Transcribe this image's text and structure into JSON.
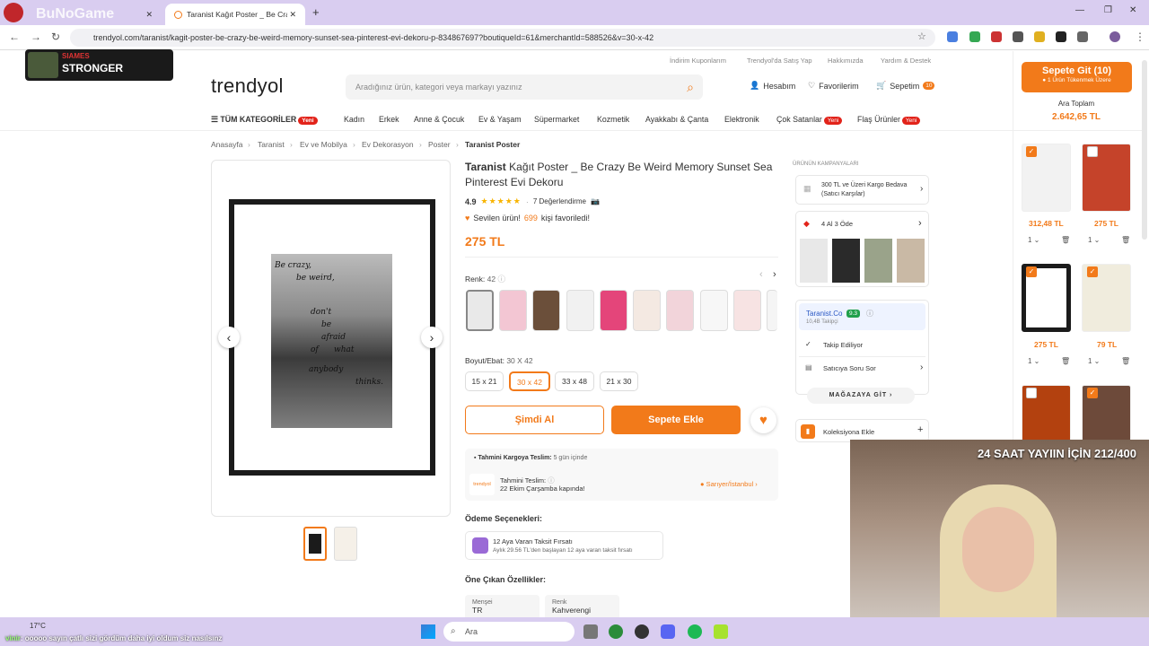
{
  "browser": {
    "tabs": [
      {
        "title": "BuNoGame",
        "active": false
      },
      {
        "title": "Taranist Kağıt Poster _ Be Crazy",
        "active": true
      }
    ],
    "url": "trendyol.com/taranist/kagit-poster-be-crazy-be-weird-memory-sunset-sea-pinterest-evi-dekoru-p-834867697?boutiqueId=61&merchantId=588526&v=30-x-42"
  },
  "overlay": {
    "stronger_top": "SIAMES",
    "stronger_main": "STRONGER",
    "stream_counter": "24 SAAT YAYIIN İÇİN 212/400"
  },
  "site": {
    "top_links": [
      "İndirim Kuponlarım",
      "Trendyol'da Satış Yap",
      "Hakkımızda",
      "Yardım & Destek"
    ],
    "logo": "trendyol",
    "search_placeholder": "Aradığınız ürün, kategori veya markayı yazınız",
    "account": "Hesabım",
    "favorites": "Favorilerim",
    "cart": "Sepetim",
    "cart_count": "10",
    "all_categories": "TÜM KATEGORİLER",
    "yeni": "Yeni",
    "categories": [
      "Kadın",
      "Erkek",
      "Anne & Çocuk",
      "Ev & Yaşam",
      "Süpermarket",
      "Kozmetik",
      "Ayakkabı & Çanta",
      "Elektronik",
      "Çok Satanlar",
      "Flaş Ürünler"
    ]
  },
  "breadcrumb": [
    "Anasayfa",
    "Taranist",
    "Ev ve Mobilya",
    "Ev Dekorasyon",
    "Poster",
    "Taranist Poster"
  ],
  "product": {
    "brand": "Taranist",
    "title": "Kağıt Poster _ Be Crazy Be Weird Memory Sunset Sea Pinterest Evi Dekoru",
    "rating": "4.9",
    "rating_stars": 5,
    "reviews": "7 Değerlendirme",
    "loved_prefix": "Sevilen ürün!",
    "loved_count": "699",
    "loved_suffix": "kişi favoriledi!",
    "price": "275 TL",
    "color_label": "Renk:",
    "color_value": "42",
    "size_label": "Boyut/Ebat:",
    "size_value": "30 X 42",
    "sizes": [
      "15 x 21",
      "30 x 42",
      "33 x 48",
      "21 x 30"
    ],
    "selected_size": "30 x 42",
    "buy_now": "Şimdi Al",
    "add_to_cart": "Sepete Ekle",
    "shipping_label": "Tahmini Kargoya Teslim:",
    "shipping_value": "5 gün içinde",
    "delivery_label": "Tahmini Teslim:",
    "delivery_value": "22 Ekim Çarşamba kapında!",
    "delivery_location": "Sarıyer/İstanbul",
    "carrier_name": "trendyol",
    "payment_title": "Ödeme Seçenekleri:",
    "installment_title": "12 Aya Varan Taksit Fırsatı",
    "installment_desc": "Aylık 29.56 TL'den başlayan 12 aya varan taksit fırsatı",
    "features_title": "Öne Çıkan Özellikler:",
    "features": [
      {
        "label": "Menşei",
        "value": "TR"
      },
      {
        "label": "Renk",
        "value": "Kahverengi"
      }
    ],
    "poster_text": [
      "Be crazy,",
      "be weird,",
      "don't",
      "be",
      "afraid",
      "of",
      "what",
      "anybody",
      "thinks."
    ]
  },
  "campaigns": {
    "title": "ÜRÜNÜN KAMPANYALARI",
    "shipping_free": "300 TL ve Üzeri Kargo Bedava (Satıcı Karşılar)",
    "deal": "4 Al 3 Öde",
    "seller_name": "Taranist.Co",
    "seller_score": "9.3",
    "followers": "10,4B Takipçi",
    "follow": "Takip Ediliyor",
    "ask": "Satıcıya Soru Sor",
    "store": "MAĞAZAYA GİT",
    "collection": "Koleksiyona Ekle"
  },
  "cart_pane": {
    "go_to_cart": "Sepete Git (10)",
    "stock_note": "1 Ürün Tükenmek Üzere",
    "subtotal_label": "Ara Toplam",
    "subtotal": "2.642,65 TL",
    "items": [
      {
        "price": "312,48 TL",
        "qty": "1"
      },
      {
        "price": "275 TL",
        "qty": "1"
      },
      {
        "price": "275 TL",
        "qty": "1"
      },
      {
        "price": "79 TL",
        "qty": "1"
      }
    ]
  },
  "taskbar": {
    "weather": "17°C",
    "search": "Ara",
    "chat_user": "vinir",
    "chat_message": ": ooooo sayın çatlı sizi gördüm daha iyi oldum siz nasılsınz"
  },
  "colors": {
    "accent": "#f27a1a",
    "red": "#e2231a",
    "chrome": "#d9cdf0"
  }
}
